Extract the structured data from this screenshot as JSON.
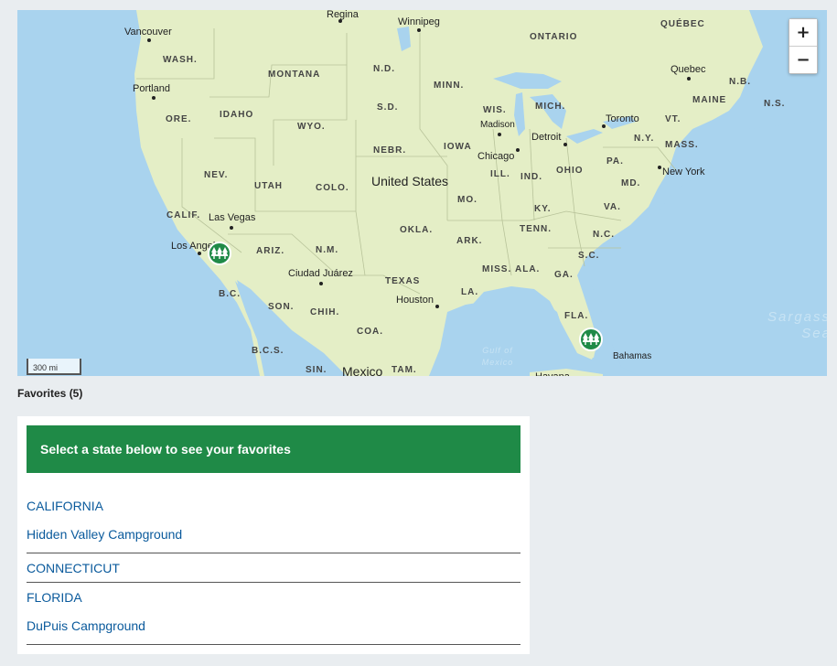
{
  "map": {
    "states": [
      "WASH.",
      "MONTANA",
      "N.D.",
      "MINN.",
      "ORE.",
      "IDAHO",
      "S.D.",
      "WIS.",
      "MICH.",
      "WYO.",
      "NEBR.",
      "IOWA",
      "NEV.",
      "UTAH",
      "COLO.",
      "ILL.",
      "IND.",
      "OHIO",
      "PA.",
      "MD.",
      "N.Y.",
      "MASS.",
      "VT.",
      "MAINE",
      "CALIF.",
      "MO.",
      "KY.",
      "VA.",
      "ARIZ.",
      "N.M.",
      "OKLA.",
      "ARK.",
      "TENN.",
      "N.C.",
      "S.C.",
      "MISS.",
      "ALA.",
      "GA.",
      "LA.",
      "TEXAS",
      "FLA.",
      "B.C.",
      "SON.",
      "CHIH.",
      "COA.",
      "B.C.S.",
      "SIN.",
      "TAM.",
      "ONTARIO",
      "QUÉBEC",
      "N.B.",
      "N.S."
    ],
    "cities": [
      "Vancouver",
      "Regina",
      "Winnipeg",
      "Portland",
      "Quebec",
      "Toronto",
      "Madison",
      "Detroit",
      "Chicago",
      "New York",
      "Las Vegas",
      "Los Angeles",
      "Ciudad Juárez",
      "Houston",
      "Bahamas",
      "Havana"
    ],
    "countries": [
      "United States",
      "Mexico"
    ],
    "waters": [
      "Sargasso Sea",
      "Gulf of Mexico"
    ],
    "scale_label": "300 mi",
    "zoom_in": "+",
    "zoom_out": "−",
    "markers": [
      "campground-marker",
      "campground-marker"
    ],
    "colors": {
      "land": "#e4eec6",
      "water": "#a9d3ee",
      "marker": "#1f8a47"
    }
  },
  "favorites": {
    "title": "Favorites (5)",
    "header": "Select a state below to see your favorites",
    "items": [
      {
        "state": "CALIFORNIA",
        "campground": "Hidden Valley Campground"
      },
      {
        "state": "CONNECTICUT"
      },
      {
        "state": "FLORIDA",
        "campground": "DuPuis Campground"
      }
    ]
  }
}
